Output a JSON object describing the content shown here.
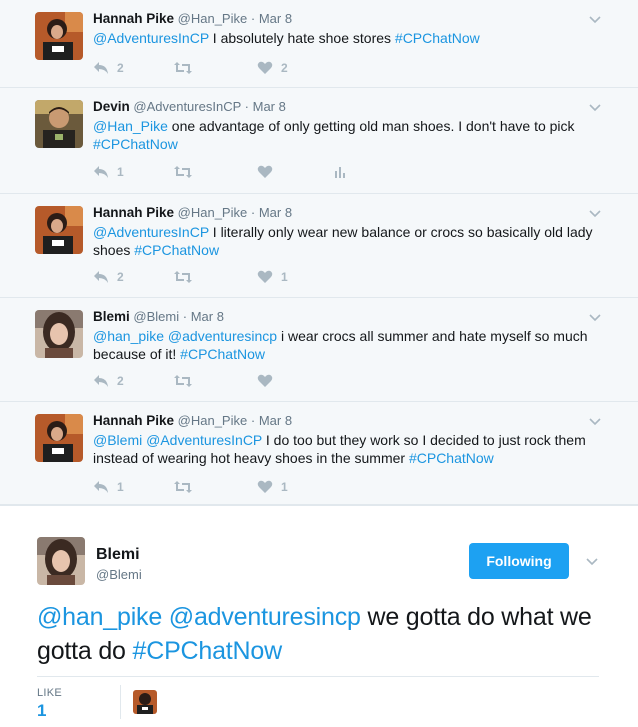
{
  "thread": [
    {
      "name": "Hannah Pike",
      "handle": "@Han_Pike",
      "sep": "·",
      "time": "Mar 8",
      "avatar": "hannah",
      "mentions": "@AdventuresInCP",
      "text": " I absolutely hate shoe stores ",
      "hashtag": "#CPChatNow",
      "replies": "2",
      "retweets": "",
      "likes": "2",
      "analytics": false
    },
    {
      "name": "Devin",
      "handle": "@AdventuresInCP",
      "sep": "·",
      "time": "Mar 8",
      "avatar": "devin",
      "mentions": "@Han_Pike",
      "text": " one advantage of only getting old man shoes. I don't have to pick ",
      "hashtag": "#CPChatNow",
      "replies": "1",
      "retweets": "",
      "likes": "",
      "analytics": true
    },
    {
      "name": "Hannah Pike",
      "handle": "@Han_Pike",
      "sep": "·",
      "time": "Mar 8",
      "avatar": "hannah",
      "mentions": "@AdventuresInCP",
      "text": " I literally only wear new balance or crocs so basically old lady shoes ",
      "hashtag": "#CPChatNow",
      "replies": "2",
      "retweets": "",
      "likes": "1",
      "analytics": false
    },
    {
      "name": "Blemi",
      "handle": "@Blemi",
      "sep": "·",
      "time": "Mar 8",
      "avatar": "blemi",
      "mentions": "@han_pike @adventuresincp",
      "text": " i wear crocs all summer and hate myself so much because of it! ",
      "hashtag": "#CPChatNow",
      "replies": "2",
      "retweets": "",
      "likes": "",
      "analytics": false
    },
    {
      "name": "Hannah Pike",
      "handle": "@Han_Pike",
      "sep": "·",
      "time": "Mar 8",
      "avatar": "hannah",
      "mentions": "@Blemi @AdventuresInCP",
      "text": " I do too but they work so I decided to just rock them instead of wearing hot heavy shoes in the summer ",
      "hashtag": "#CPChatNow",
      "replies": "1",
      "retweets": "",
      "likes": "1",
      "analytics": false
    }
  ],
  "main": {
    "name": "Blemi",
    "handle": "@Blemi",
    "follow_label": "Following",
    "mentions": "@han_pike @adventuresincp",
    "text": " we gotta do what we gotta do ",
    "hashtag": "#CPChatNow",
    "likes_label": "LIKE",
    "likes_count": "1"
  },
  "colors": {
    "link": "#1b95e0",
    "button": "#1da1f2",
    "icon": "#aab8c2",
    "thread_bg": "#f5f8fa"
  },
  "icons": {
    "reply": "reply-icon",
    "retweet": "retweet-icon",
    "like": "heart-icon",
    "analytics": "analytics-icon",
    "menu": "chevron-down-icon"
  }
}
